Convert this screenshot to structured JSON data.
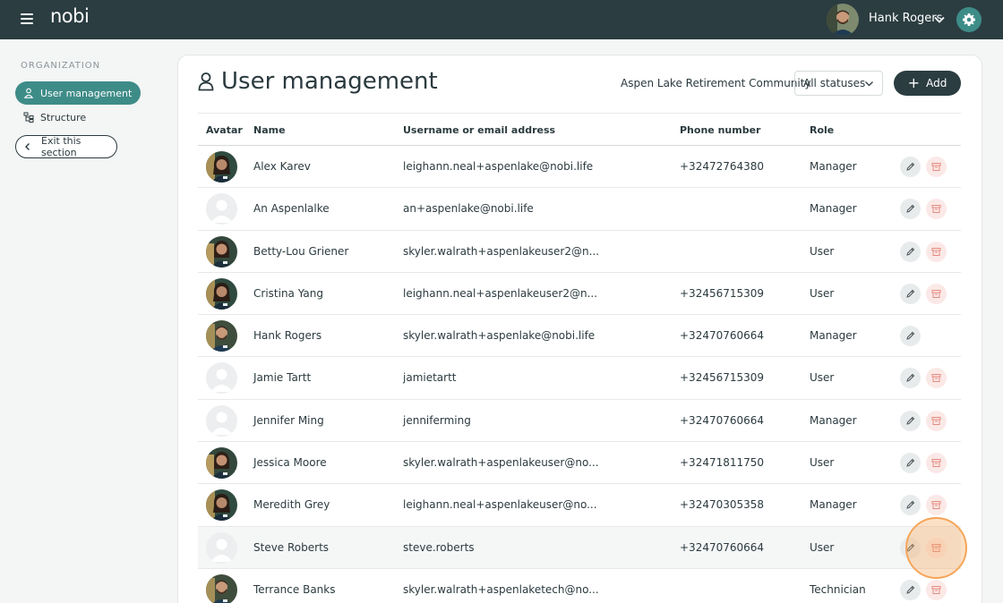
{
  "app": {
    "logo": "nobi"
  },
  "header": {
    "user_name": "Hank Rogers",
    "user_avatar_icon": "user-photo-icon",
    "settings_icon": "gear-icon"
  },
  "sidebar": {
    "heading": "ORGANIZATION",
    "items": [
      {
        "label": "User management",
        "icon": "user-icon",
        "active": true
      },
      {
        "label": "Structure",
        "icon": "structure-icon",
        "active": false
      }
    ],
    "exit_label": "Exit this section"
  },
  "main": {
    "title": "User management",
    "organization": "Aspen Lake Retirement Community",
    "status_filter": "All statuses",
    "add_label": "Add"
  },
  "table": {
    "columns": [
      "Avatar",
      "Name",
      "Username or email address",
      "Phone number",
      "Role"
    ],
    "rows": [
      {
        "name": "Alex Karev",
        "username": "leighann.neal+aspenlake@nobi.life",
        "phone": "+32472764380",
        "role": "Manager",
        "photo": true,
        "photo_kind": "female",
        "archive": true
      },
      {
        "name": "An Aspenlalke",
        "username": "an+aspenlake@nobi.life",
        "phone": "",
        "role": "Manager",
        "photo": false,
        "archive": true
      },
      {
        "name": "Betty-Lou Griener",
        "username": "skyler.walrath+aspenlakeuser2@n...",
        "phone": "",
        "role": "User",
        "photo": true,
        "photo_kind": "female2",
        "archive": true
      },
      {
        "name": "Cristina Yang",
        "username": "leighann.neal+aspenlakeuser2@n...",
        "phone": "+32456715309",
        "role": "User",
        "photo": true,
        "photo_kind": "female",
        "archive": true
      },
      {
        "name": "Hank Rogers",
        "username": "skyler.walrath+aspenlake@nobi.life",
        "phone": "+32470760664",
        "role": "Manager",
        "photo": true,
        "photo_kind": "male",
        "archive": false
      },
      {
        "name": "Jamie Tartt",
        "username": "jamietartt",
        "phone": "+32456715309",
        "role": "User",
        "photo": false,
        "archive": true
      },
      {
        "name": "Jennifer Ming",
        "username": "jenniferming",
        "phone": "+32470760664",
        "role": "Manager",
        "photo": false,
        "archive": true
      },
      {
        "name": "Jessica Moore",
        "username": "skyler.walrath+aspenlakeuser@no...",
        "phone": "+32471811750",
        "role": "User",
        "photo": true,
        "photo_kind": "female2",
        "archive": true
      },
      {
        "name": "Meredith Grey",
        "username": "leighann.neal+aspenlakeuser@no...",
        "phone": "+32470305358",
        "role": "Manager",
        "photo": true,
        "photo_kind": "female",
        "archive": true
      },
      {
        "name": "Steve Roberts",
        "username": "steve.roberts",
        "phone": "+32470760664",
        "role": "User",
        "photo": false,
        "archive": true,
        "hovered": true
      },
      {
        "name": "Terrance Banks",
        "username": "skyler.walrath+aspenlaketech@no...",
        "phone": "",
        "role": "Technician",
        "photo": true,
        "photo_kind": "male",
        "archive": true
      }
    ]
  },
  "colors": {
    "topbar": "#2b3d41",
    "accent": "#3e8c88",
    "archive_bg": "#fbe9e7",
    "archive_icon": "#e58a7f",
    "click_marker": "#f5a55a"
  }
}
